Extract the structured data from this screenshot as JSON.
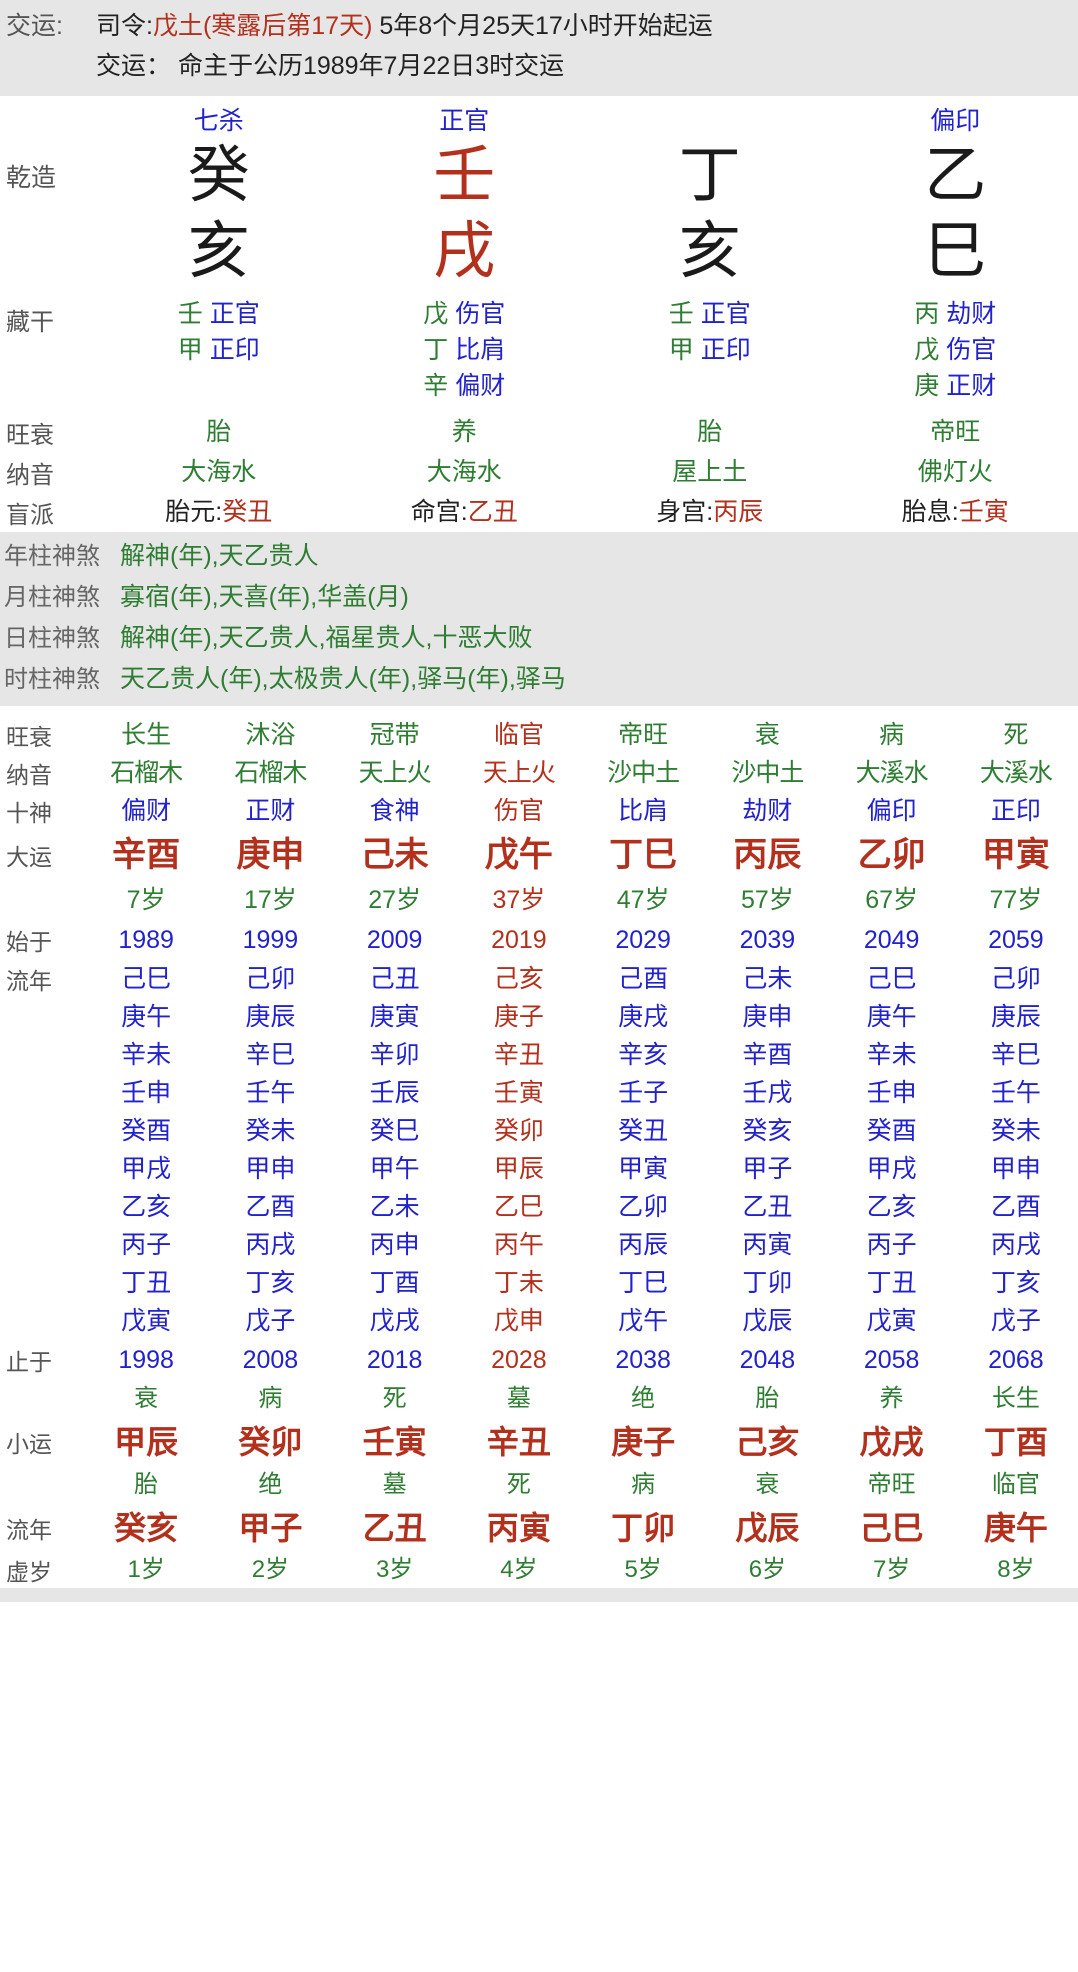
{
  "header": {
    "label": "交运:",
    "line1_prefix": "司令:",
    "line1_red": "戊土(寒露后第17天)",
    "line1_suffix": " 5年8个月25天17小时开始起运",
    "line2": "交运： 命主于公历1989年7月22日3时交运"
  },
  "pillars": {
    "row_labels": {
      "gender": "乾造",
      "canggan": "藏干",
      "wangshuai": "旺衰",
      "nayin": "纳音",
      "mangpai": "盲派"
    },
    "shishen": [
      "七杀",
      "正官",
      "",
      "偏印"
    ],
    "gan": [
      {
        "char": "癸",
        "color": "black"
      },
      {
        "char": "壬",
        "color": "red"
      },
      {
        "char": "丁",
        "color": "black"
      },
      {
        "char": "乙",
        "color": "black"
      }
    ],
    "zhi": [
      {
        "char": "亥",
        "color": "black"
      },
      {
        "char": "戌",
        "color": "red"
      },
      {
        "char": "亥",
        "color": "black"
      },
      {
        "char": "巳",
        "color": "black"
      }
    ],
    "canggan": [
      [
        {
          "gan": "壬",
          "shen": "正官"
        },
        {
          "gan": "甲",
          "shen": "正印"
        }
      ],
      [
        {
          "gan": "戊",
          "shen": "伤官"
        },
        {
          "gan": "丁",
          "shen": "比肩"
        },
        {
          "gan": "辛",
          "shen": "偏财"
        }
      ],
      [
        {
          "gan": "壬",
          "shen": "正官"
        },
        {
          "gan": "甲",
          "shen": "正印"
        }
      ],
      [
        {
          "gan": "丙",
          "shen": "劫财"
        },
        {
          "gan": "戊",
          "shen": "伤官"
        },
        {
          "gan": "庚",
          "shen": "正财"
        }
      ]
    ],
    "wangshuai": [
      "胎",
      "养",
      "胎",
      "帝旺"
    ],
    "nayin": [
      "大海水",
      "大海水",
      "屋上土",
      "佛灯火"
    ],
    "mangpai": [
      {
        "key": "胎元:",
        "val": "癸丑"
      },
      {
        "key": "命宫:",
        "val": "乙丑"
      },
      {
        "key": "身宫:",
        "val": "丙辰"
      },
      {
        "key": "胎息:",
        "val": "壬寅"
      }
    ]
  },
  "shensha": [
    {
      "label": "年柱神煞",
      "value": "解神(年),天乙贵人"
    },
    {
      "label": "月柱神煞",
      "value": "寡宿(年),天喜(年),华盖(月)"
    },
    {
      "label": "日柱神煞",
      "value": "解神(年),天乙贵人,福星贵人,十恶大败"
    },
    {
      "label": "时柱神煞",
      "value": "天乙贵人(年),太极贵人(年),驿马(年),驿马"
    }
  ],
  "dayun": {
    "labels": {
      "wangshuai": "旺衰",
      "nayin": "纳音",
      "shishen": "十神",
      "dayun": "大运",
      "age": "",
      "start": "始于",
      "liunian": "流年",
      "end": "止于",
      "xiaoyun": "小运",
      "bottom_liunian": "流年",
      "xusui": "虚岁"
    },
    "highlight_index": 3,
    "wangshuai": [
      "长生",
      "沐浴",
      "冠带",
      "临官",
      "帝旺",
      "衰",
      "病",
      "死"
    ],
    "nayin": [
      "石榴木",
      "石榴木",
      "天上火",
      "天上火",
      "沙中土",
      "沙中土",
      "大溪水",
      "大溪水"
    ],
    "shishen": [
      "偏财",
      "正财",
      "食神",
      "伤官",
      "比肩",
      "劫财",
      "偏印",
      "正印"
    ],
    "pillars": [
      "辛酉",
      "庚申",
      "己未",
      "戊午",
      "丁巳",
      "丙辰",
      "乙卯",
      "甲寅"
    ],
    "ages": [
      "7岁",
      "17岁",
      "27岁",
      "37岁",
      "47岁",
      "57岁",
      "67岁",
      "77岁"
    ],
    "start_years": [
      "1989",
      "1999",
      "2009",
      "2019",
      "2029",
      "2039",
      "2049",
      "2059"
    ],
    "end_years": [
      "1998",
      "2008",
      "2018",
      "2028",
      "2038",
      "2048",
      "2058",
      "2068"
    ],
    "liunian_rows": [
      [
        "己巳",
        "己卯",
        "己丑",
        "己亥",
        "己酉",
        "己未",
        "己巳",
        "己卯"
      ],
      [
        "庚午",
        "庚辰",
        "庚寅",
        "庚子",
        "庚戌",
        "庚申",
        "庚午",
        "庚辰"
      ],
      [
        "辛未",
        "辛巳",
        "辛卯",
        "辛丑",
        "辛亥",
        "辛酉",
        "辛未",
        "辛巳"
      ],
      [
        "壬申",
        "壬午",
        "壬辰",
        "壬寅",
        "壬子",
        "壬戌",
        "壬申",
        "壬午"
      ],
      [
        "癸酉",
        "癸未",
        "癸巳",
        "癸卯",
        "癸丑",
        "癸亥",
        "癸酉",
        "癸未"
      ],
      [
        "甲戌",
        "甲申",
        "甲午",
        "甲辰",
        "甲寅",
        "甲子",
        "甲戌",
        "甲申"
      ],
      [
        "乙亥",
        "乙酉",
        "乙未",
        "乙巳",
        "乙卯",
        "乙丑",
        "乙亥",
        "乙酉"
      ],
      [
        "丙子",
        "丙戌",
        "丙申",
        "丙午",
        "丙辰",
        "丙寅",
        "丙子",
        "丙戌"
      ],
      [
        "丁丑",
        "丁亥",
        "丁酉",
        "丁未",
        "丁巳",
        "丁卯",
        "丁丑",
        "丁亥"
      ],
      [
        "戊寅",
        "戊子",
        "戊戌",
        "戊申",
        "戊午",
        "戊辰",
        "戊寅",
        "戊子"
      ]
    ],
    "bottom_state_top": [
      "衰",
      "病",
      "死",
      "墓",
      "绝",
      "胎",
      "养",
      "长生"
    ],
    "xiaoyun": [
      "甲辰",
      "癸卯",
      "壬寅",
      "辛丑",
      "庚子",
      "己亥",
      "戊戌",
      "丁酉"
    ],
    "bottom_state_low": [
      "胎",
      "绝",
      "墓",
      "死",
      "病",
      "衰",
      "帝旺",
      "临官"
    ],
    "bottom_liunian": [
      "癸亥",
      "甲子",
      "乙丑",
      "丙寅",
      "丁卯",
      "戊辰",
      "己巳",
      "庚午"
    ],
    "xusui": [
      "1岁",
      "2岁",
      "3岁",
      "4岁",
      "5岁",
      "6岁",
      "7岁",
      "8岁"
    ]
  }
}
